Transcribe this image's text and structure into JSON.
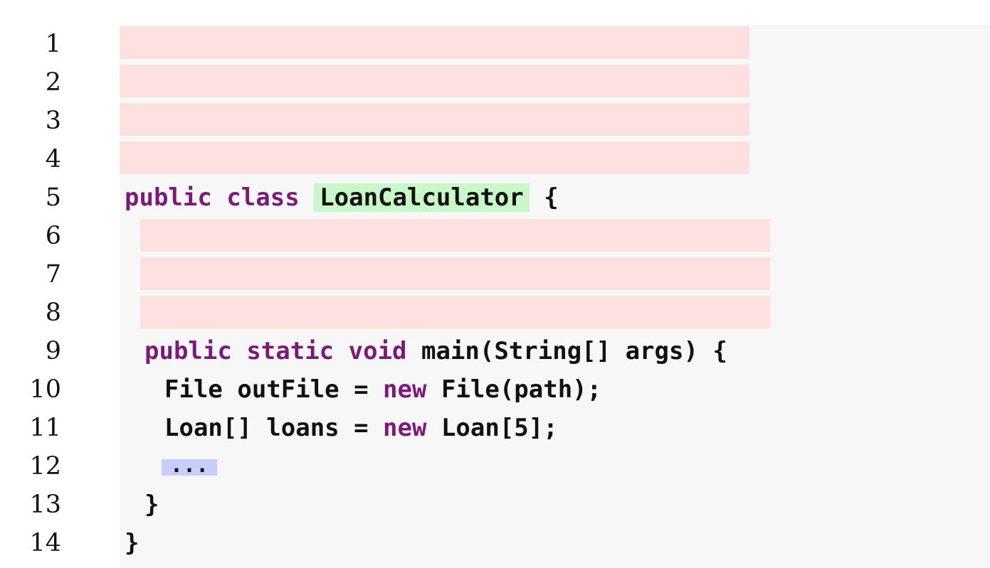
{
  "editor": {
    "line_numbers": [
      "1",
      "2",
      "3",
      "4",
      "5",
      "6",
      "7",
      "8",
      "9",
      "10",
      "11",
      "12",
      "13",
      "14"
    ],
    "line5": {
      "kw1": "public",
      "kw2": "class",
      "class_name": "LoanCalculator",
      "brace": "{"
    },
    "line9": {
      "kw1": "public",
      "kw2": "static",
      "kw3": "void",
      "rest": "main(String[] args) {"
    },
    "line10": {
      "pre": "File outFile = ",
      "kw": "new",
      "post": " File(path);"
    },
    "line11": {
      "pre": "Loan[] loans = ",
      "kw": "new",
      "post": " Loan[5];"
    },
    "line12": {
      "ellipsis": "..."
    },
    "line13": {
      "text": "}"
    },
    "line14": {
      "text": "}"
    }
  },
  "colors": {
    "keyword": "#7b1a78",
    "redaction": "#fde1e1",
    "class_highlight": "#c9f7c9",
    "ellipsis_highlight": "#c9cdfb",
    "panel_background": "#f7f7f7"
  }
}
